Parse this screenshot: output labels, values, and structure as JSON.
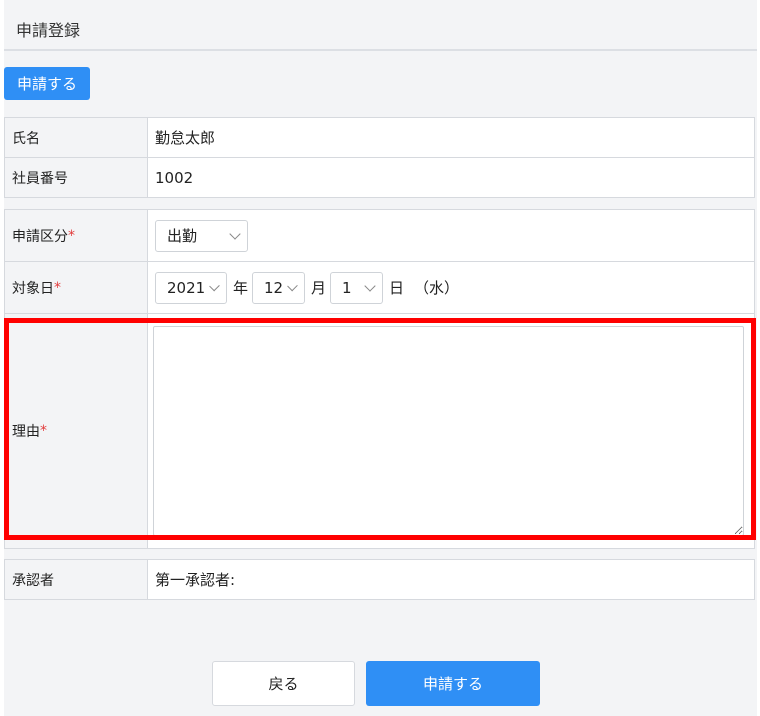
{
  "page": {
    "title": "申請登録"
  },
  "toolbar": {
    "submit_label": "申請する"
  },
  "employee": {
    "name_label": "氏名",
    "name_value": "勤怠太郎",
    "id_label": "社員番号",
    "id_value": "1002"
  },
  "form": {
    "required_mark": "*",
    "type_label": "申請区分",
    "type_value": "出勤",
    "date_label": "対象日",
    "year_value": "2021",
    "year_unit": "年",
    "month_value": "12",
    "month_unit": "月",
    "day_value": "1",
    "day_unit": "日",
    "weekday": "（水）",
    "reason_label": "理由",
    "reason_value": ""
  },
  "approver": {
    "label": "承認者",
    "value": "第一承認者:"
  },
  "footer": {
    "back_label": "戻る",
    "submit_label": "申請する"
  },
  "colors": {
    "primary": "#2f8ff5",
    "required": "#e23b3b",
    "highlight": "#ff0000"
  }
}
